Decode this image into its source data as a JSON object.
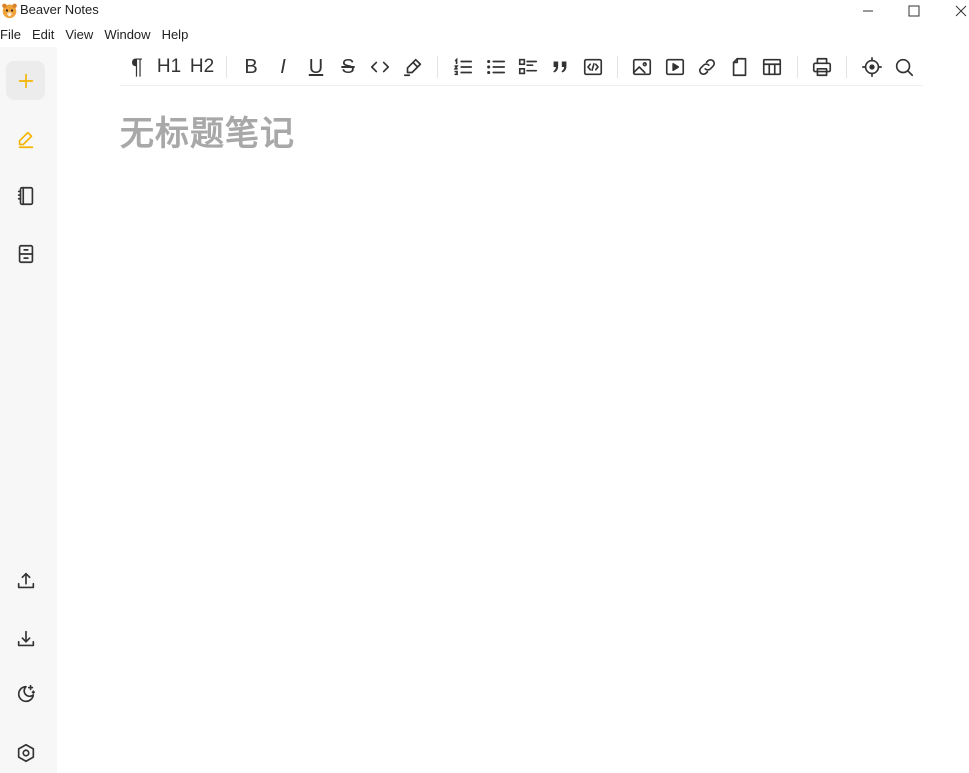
{
  "window": {
    "title": "Beaver Notes",
    "controls": [
      "minimize-icon",
      "maximize-icon",
      "close-icon"
    ]
  },
  "menu": [
    "File",
    "Edit",
    "View",
    "Window",
    "Help"
  ],
  "sidebar": {
    "top": [
      {
        "name": "add-note-button",
        "icon": "plus-icon",
        "active": true
      },
      {
        "name": "notes-button",
        "icon": "pencil-icon"
      },
      {
        "name": "notebook-button",
        "icon": "notebook-icon"
      },
      {
        "name": "archive-button",
        "icon": "archive-icon"
      }
    ],
    "bottom": [
      {
        "name": "export-button",
        "icon": "upload-icon"
      },
      {
        "name": "import-button",
        "icon": "download-icon"
      },
      {
        "name": "dark-mode-button",
        "icon": "moon-stars-icon"
      },
      {
        "name": "settings-button",
        "icon": "hexagon-settings-icon"
      }
    ]
  },
  "toolbar": {
    "paragraph_label": "¶",
    "h1_label": "H1",
    "h2_label": "H2",
    "bold_label": "B",
    "italic_label": "I",
    "underline_label": "U",
    "strike_label": "S"
  },
  "editor": {
    "title_placeholder": "无标题笔记"
  },
  "colors": {
    "accent": "#f5b400",
    "sidebar_bg": "#f7f7f7",
    "icon": "#333333",
    "placeholder": "#a8a8a8"
  }
}
